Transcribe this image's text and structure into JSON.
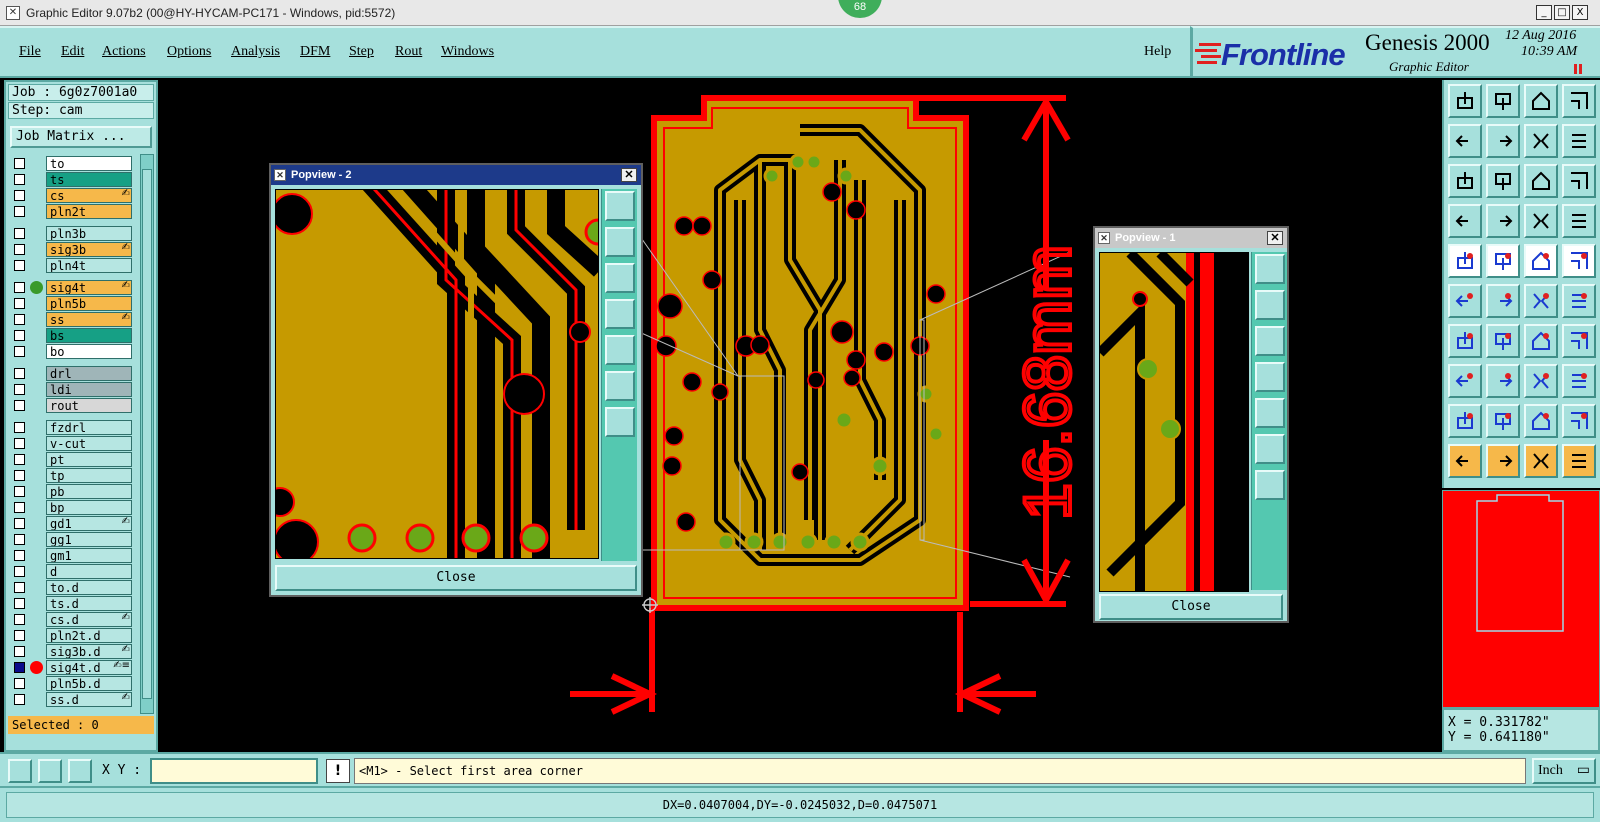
{
  "window": {
    "title": "Graphic Editor 9.07b2 (00@HY-HYCAM-PC171 - Windows, pid:5572)",
    "badge": "68",
    "minimize": "_",
    "restore": "□",
    "close": "X"
  },
  "menu": {
    "items": [
      "File",
      "Edit",
      "Actions",
      "Options",
      "Analysis",
      "DFM",
      "Step",
      "Rout",
      "Windows"
    ],
    "help": "Help"
  },
  "brand": {
    "logo": "Frontline",
    "product": "Genesis 2000",
    "subtitle": "Graphic Editor",
    "date": "12 Aug 2016",
    "time": "10:39 AM"
  },
  "job": {
    "job_line": "Job : 6g0z7001a0",
    "step_line": "Step: cam",
    "matrix_button": "Job Matrix ...",
    "selected": "Selected : 0"
  },
  "layers": [
    {
      "name": "to",
      "color": "#ffffff",
      "group": 0
    },
    {
      "name": "ts",
      "color": "#16a085",
      "group": 0
    },
    {
      "name": "cs",
      "color": "#f6b84a",
      "group": 0,
      "mark": "✍"
    },
    {
      "name": "pln2t",
      "color": "#f6b84a",
      "group": 0
    },
    {
      "name": "pln3b",
      "color": "#b6e6e2",
      "group": 1
    },
    {
      "name": "sig3b",
      "color": "#f6b84a",
      "group": 1,
      "mark": "✍"
    },
    {
      "name": "pln4t",
      "color": "#b6e6e2",
      "group": 1
    },
    {
      "name": "sig4t",
      "color": "#f6b84a",
      "group": 2,
      "mark": "✍",
      "dot": "#3a9a2a"
    },
    {
      "name": "pln5b",
      "color": "#f6b84a",
      "group": 2
    },
    {
      "name": "ss",
      "color": "#f6b84a",
      "group": 2,
      "mark": "✍"
    },
    {
      "name": "bs",
      "color": "#16a085",
      "group": 2
    },
    {
      "name": "bo",
      "color": "#ffffff",
      "group": 2
    },
    {
      "name": "drl",
      "color": "#9fb5b8",
      "group": 3
    },
    {
      "name": "ldi",
      "color": "#9fb5b8",
      "group": 3
    },
    {
      "name": "rout",
      "color": "#d7d7d7",
      "group": 3
    },
    {
      "name": "fzdrl",
      "color": "#b6e6e2",
      "group": 4
    },
    {
      "name": "v-cut",
      "color": "#b6e6e2",
      "group": 4
    },
    {
      "name": "pt",
      "color": "#b6e6e2",
      "group": 4
    },
    {
      "name": "tp",
      "color": "#b6e6e2",
      "group": 4
    },
    {
      "name": "pb",
      "color": "#b6e6e2",
      "group": 4
    },
    {
      "name": "bp",
      "color": "#b6e6e2",
      "group": 4
    },
    {
      "name": "gd1",
      "color": "#b6e6e2",
      "group": 4,
      "mark": "✍"
    },
    {
      "name": "gg1",
      "color": "#b6e6e2",
      "group": 4
    },
    {
      "name": "gm1",
      "color": "#b6e6e2",
      "group": 4
    },
    {
      "name": "d",
      "color": "#b6e6e2",
      "group": 4
    },
    {
      "name": "to.d",
      "color": "#b6e6e2",
      "group": 4
    },
    {
      "name": "ts.d",
      "color": "#b6e6e2",
      "group": 4
    },
    {
      "name": "cs.d",
      "color": "#b6e6e2",
      "group": 4,
      "mark": "✍"
    },
    {
      "name": "pln2t.d",
      "color": "#b6e6e2",
      "group": 4
    },
    {
      "name": "sig3b.d",
      "color": "#b6e6e2",
      "group": 4,
      "mark": "✍"
    },
    {
      "name": "sig4t.d",
      "color": "#b6e6e2",
      "group": 4,
      "mark": "✍≡",
      "dot": "#ff0000",
      "checked": true
    },
    {
      "name": "pln5b.d",
      "color": "#b6e6e2",
      "group": 4
    },
    {
      "name": "ss.d",
      "color": "#b6e6e2",
      "group": 4,
      "mark": "✍"
    }
  ],
  "canvas": {
    "dimension_label": "16.68mm"
  },
  "popview2": {
    "title": "Popview - 2",
    "close_label": "Close"
  },
  "popview1": {
    "title": "Popview - 1",
    "close_label": "Close"
  },
  "coords": {
    "x": "X = 0.331782\"",
    "y": "Y = 0.641180\""
  },
  "command": {
    "xy_label": "X Y :",
    "xy_value": "",
    "warn": "!",
    "prompt": "<M1> - Select first area corner",
    "units": "Inch"
  },
  "status": {
    "text": "DX=0.0407004,DY=-0.0245032,D=0.0475071"
  },
  "colors": {
    "panel": "#a6e0dc",
    "copper": "#c69a00",
    "highlight": "#ff0000",
    "pad": "#6aa818"
  }
}
